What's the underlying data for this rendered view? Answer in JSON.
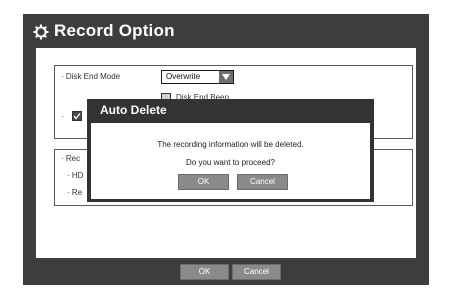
{
  "window": {
    "title": "Record Option",
    "icon": "gear-icon"
  },
  "disk_end": {
    "label": "· Disk End Mode",
    "mode_value": "Overwrite",
    "beep_label": "Disk End Beep",
    "partial_label": "· "
  },
  "section2": {
    "label_1": "· Rec",
    "label_2": "· HD",
    "label_3": "· Re"
  },
  "dialog": {
    "title": "Auto Delete",
    "message_1": "The recording information will be deleted.",
    "message_2": "Do you want to proceed?",
    "ok_label": "OK",
    "cancel_label": "Cancel"
  },
  "footer": {
    "ok_label": "OK",
    "cancel_label": "Cancel"
  },
  "colors": {
    "frame": "#3d3d3d",
    "button": "#8a8a8a",
    "dialog": "#333333"
  }
}
